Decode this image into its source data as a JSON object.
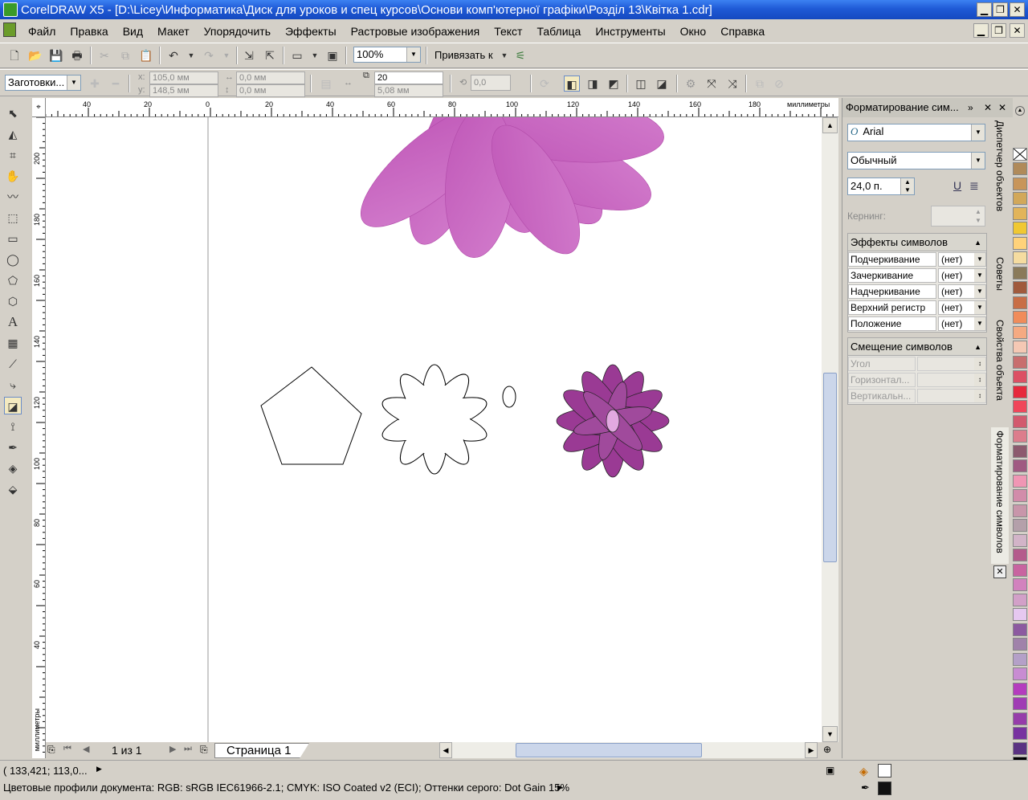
{
  "window": {
    "title": "CorelDRAW X5 - [D:\\Licey\\Информатика\\Диск для уроков и спец курсов\\Основи комп'ютерної графіки\\Розділ 13\\Квітка 1.cdr]",
    "minimize": "▁",
    "restore": "❐",
    "close": "✕"
  },
  "menu": [
    "Файл",
    "Правка",
    "Вид",
    "Макет",
    "Упорядочить",
    "Эффекты",
    "Растровые изображения",
    "Текст",
    "Таблица",
    "Инструменты",
    "Окно",
    "Справка"
  ],
  "toolbar": {
    "zoom": "100%",
    "snap": "Привязать к"
  },
  "propbar": {
    "presets": "Заготовки...",
    "x_label": "x:",
    "x": "105,0 мм",
    "y_label": "y:",
    "y": "148,5 мм",
    "w": "0,0 мм",
    "h": "0,0 мм",
    "steps": "20",
    "offset": "5,08 мм",
    "angle": "0,0"
  },
  "ruler": {
    "h_ticks": [
      "40",
      "20",
      "0",
      "20",
      "40",
      "60",
      "80",
      "100",
      "120",
      "140",
      "160",
      "180"
    ],
    "unit": "миллиметры",
    "v_ticks": [
      "200",
      "180",
      "160",
      "140",
      "120",
      "100",
      "80",
      "60",
      "40"
    ],
    "v_unit": "миллиметры"
  },
  "pages": {
    "count": "1 из 1",
    "tab": "Страница 1"
  },
  "docker": {
    "title": "Форматирование сим...",
    "font": "Arial",
    "style": "Обычный",
    "size": "24,0 п.",
    "kerning_label": "Кернинг:",
    "effects_header": "Эффекты символов",
    "effects": [
      {
        "label": "Подчеркивание",
        "value": "(нет)"
      },
      {
        "label": "Зачеркивание",
        "value": "(нет)"
      },
      {
        "label": "Надчеркивание",
        "value": "(нет)"
      },
      {
        "label": "Верхний регистр",
        "value": "(нет)"
      },
      {
        "label": "Положение",
        "value": "(нет)"
      }
    ],
    "shift_header": "Смещение символов",
    "shift": [
      {
        "label": "Угол"
      },
      {
        "label": "Горизонтал..."
      },
      {
        "label": "Вертикальн..."
      }
    ]
  },
  "side_tabs": [
    "Диспетчер объектов",
    "Советы",
    "Свойства объекта",
    "Форматирование символов"
  ],
  "palette": [
    "#ffffff",
    "#b08a5a",
    "#c8955a",
    "#d2a85a",
    "#e2b45a",
    "#f0c832",
    "#ffd27a",
    "#f5dca0",
    "#8a7a5a",
    "#a05a3c",
    "#c86e46",
    "#f08c5a",
    "#f5aa82",
    "#f5c8b4",
    "#c86e6e",
    "#dc5064",
    "#e6283c",
    "#f0465a",
    "#d25a6e",
    "#dc7d8c",
    "#8c5a6e",
    "#a05a82",
    "#f096b4",
    "#d28caa",
    "#c896aa",
    "#b4a0aa",
    "#d2b4c8",
    "#b45a8c",
    "#c864a0",
    "#d282be",
    "#d2a0c8",
    "#e6c8f0",
    "#8c5aa0",
    "#a082aa",
    "#b4a0c8",
    "#c88cd2",
    "#b43cbe",
    "#a03cb4",
    "#963caa",
    "#7832a0",
    "#5a3282",
    "#000000"
  ],
  "status": {
    "coords": "( 133,421; 113,0... ",
    "profiles": "Цветовые профили документа: RGB: sRGB IEC61966-2.1; CMYK: ISO Coated v2 (ECI); Оттенки серого: Dot Gain 15%"
  }
}
